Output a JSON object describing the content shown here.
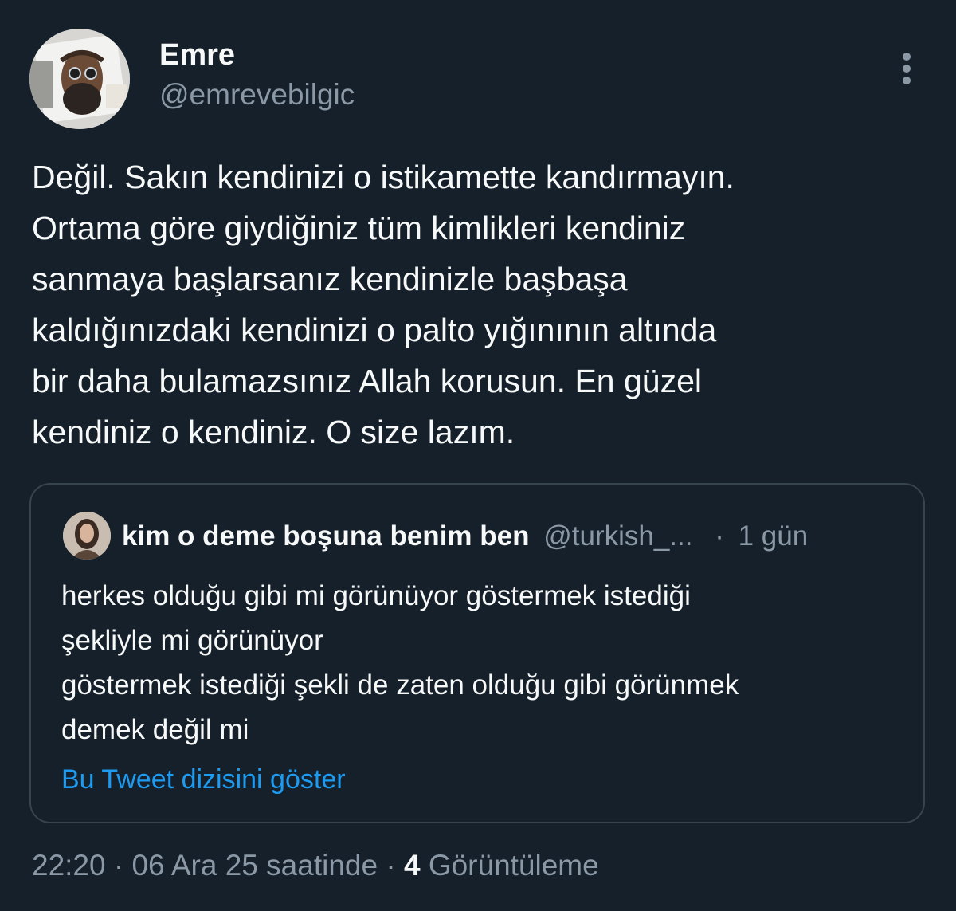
{
  "author": {
    "name": "Emre",
    "handle": "@emrevebilgic"
  },
  "tweet": {
    "lines": [
      "Değil. Sakın kendinizi o istikamette kandırmayın.",
      "Ortama göre giydiğiniz tüm kimlikleri kendiniz",
      "sanmaya başlarsanız kendinizle başbaşa",
      "kaldığınızdaki kendinizi o palto yığınının altında",
      "bir daha bulamazsınız Allah korusun. En güzel",
      "kendiniz o kendiniz. O size lazım."
    ]
  },
  "quote": {
    "name": "kim o deme boşuna benim ben",
    "handle": "@turkish_...",
    "separator": "·",
    "time": "1 gün",
    "lines": [
      "herkes olduğu gibi mi görünüyor göstermek istediği",
      "şekliyle mi görünüyor",
      "göstermek istediği şekli de zaten olduğu gibi görünmek",
      "demek değil mi"
    ],
    "show_thread": "Bu Tweet dizisini göster"
  },
  "meta": {
    "time": "22:20",
    "sep1": "·",
    "date": "06 Ara 25 saatinde",
    "sep2": "·",
    "views_count": "4",
    "views_label": "Görüntüleme"
  },
  "colors": {
    "background": "#15202b",
    "text": "#f7f9f9",
    "secondary": "#8b98a5",
    "link": "#1d9bf0",
    "border": "#38444d"
  },
  "icons": {
    "more": "more-vertical-icon"
  }
}
